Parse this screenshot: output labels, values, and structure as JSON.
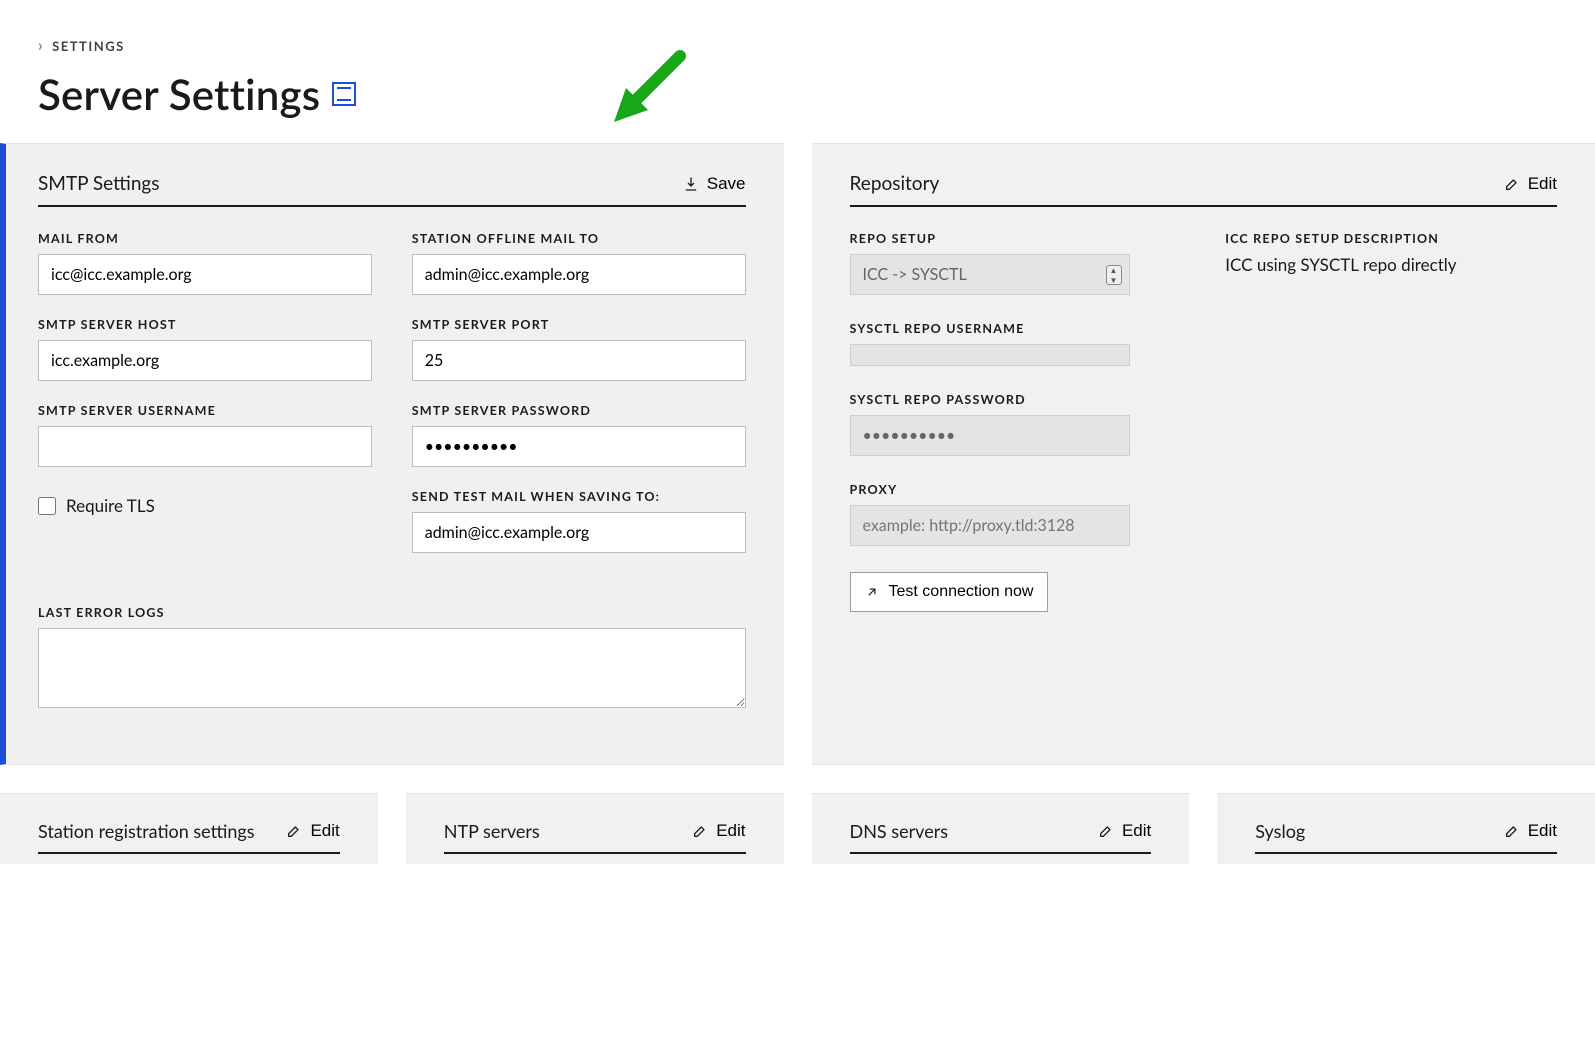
{
  "breadcrumb": {
    "settings": "SETTINGS"
  },
  "page_title": "Server Settings",
  "smtp": {
    "panel_title": "SMTP Settings",
    "action_label": "Save",
    "fields": {
      "mail_from_label": "MAIL FROM",
      "mail_from_value": "icc@icc.example.org",
      "offline_mail_label": "STATION OFFLINE MAIL TO",
      "offline_mail_value": "admin@icc.example.org",
      "host_label": "SMTP SERVER HOST",
      "host_value": "icc.example.org",
      "port_label": "SMTP SERVER PORT",
      "port_value": "25",
      "user_label": "SMTP SERVER USERNAME",
      "user_value": "",
      "pass_label": "SMTP SERVER PASSWORD",
      "pass_value": "••••••••••",
      "require_tls_label": "Require TLS",
      "test_mail_label": "SEND TEST MAIL WHEN SAVING TO:",
      "test_mail_value": "admin@icc.example.org",
      "logs_label": "LAST ERROR LOGS",
      "logs_value": ""
    }
  },
  "repo": {
    "panel_title": "Repository",
    "action_label": "Edit",
    "fields": {
      "setup_label": "REPO SETUP",
      "setup_value": "ICC -> SYSCTL",
      "desc_label": "ICC REPO SETUP DESCRIPTION",
      "desc_value": "ICC using SYSCTL repo directly",
      "user_label": "SYSCTL REPO USERNAME",
      "user_value": "",
      "pass_label": "SYSCTL REPO PASSWORD",
      "pass_value": "••••••••••",
      "proxy_label": "PROXY",
      "proxy_placeholder": "example: http://proxy.tld:3128",
      "test_btn": "Test connection now"
    }
  },
  "bottom": {
    "station": {
      "title": "Station registration settings",
      "action": "Edit"
    },
    "ntp": {
      "title": "NTP servers",
      "action": "Edit"
    },
    "dns": {
      "title": "DNS servers",
      "action": "Edit"
    },
    "syslog": {
      "title": "Syslog",
      "action": "Edit"
    }
  }
}
